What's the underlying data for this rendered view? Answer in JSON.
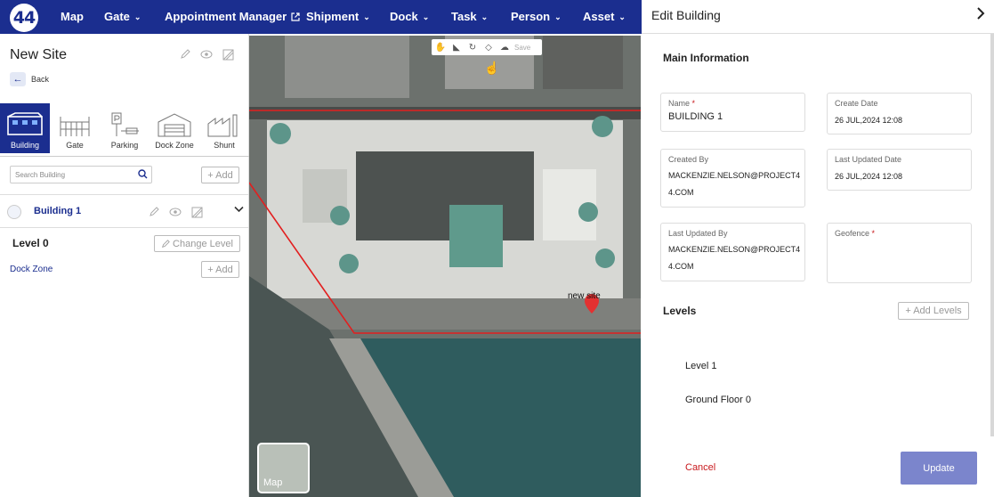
{
  "nav": {
    "logo": "44",
    "items": [
      {
        "label": "Map",
        "chevron": false,
        "external": false
      },
      {
        "label": "Gate",
        "chevron": true,
        "external": false
      },
      {
        "label": "Appointment Manager",
        "chevron": false,
        "external": true
      },
      {
        "label": "Shipment",
        "chevron": true,
        "external": false
      },
      {
        "label": "Dock",
        "chevron": true,
        "external": false
      },
      {
        "label": "Task",
        "chevron": true,
        "external": false
      },
      {
        "label": "Person",
        "chevron": true,
        "external": false
      },
      {
        "label": "Asset",
        "chevron": true,
        "external": false
      }
    ]
  },
  "left": {
    "title": "New Site",
    "back_label": "Back",
    "categories": [
      {
        "label": "Building",
        "active": true
      },
      {
        "label": "Gate",
        "active": false
      },
      {
        "label": "Parking",
        "active": false
      },
      {
        "label": "Dock Zone",
        "active": false
      },
      {
        "label": "Shunt",
        "active": false
      }
    ],
    "search_placeholder": "Search Building",
    "add_label": "+ Add",
    "building_name": "Building 1",
    "level_name": "Level 0",
    "change_level_label": "Change Level",
    "dock_zone_label": "Dock Zone",
    "dock_add_label": "+ Add"
  },
  "map": {
    "toolbar_save": "Save",
    "site_label": "new site",
    "thumb_label": "Map"
  },
  "panel": {
    "title": "Edit Building",
    "main_info": "Main Information",
    "name_label": "Name",
    "name_value": "BUILDING 1",
    "create_date_label": "Create Date",
    "create_date_value": "26 JUL,2024 12:08",
    "created_by_label": "Created By",
    "created_by_value": "MACKENZIE.NELSON@PROJECT44.COM",
    "last_updated_date_label": "Last Updated Date",
    "last_updated_date_value": "26 JUL,2024 12:08",
    "last_updated_by_label": "Last Updated By",
    "last_updated_by_value": "MACKENZIE.NELSON@PROJECT44.COM",
    "geofence_label": "Geofence",
    "levels_label": "Levels",
    "add_levels_label": "+ Add Levels",
    "levels": [
      "Level 1",
      "Ground Floor 0"
    ],
    "cancel_label": "Cancel",
    "update_label": "Update"
  },
  "colors": {
    "brand": "#1b2e8f",
    "danger": "#c8191d",
    "update_button": "#7b85cc"
  }
}
